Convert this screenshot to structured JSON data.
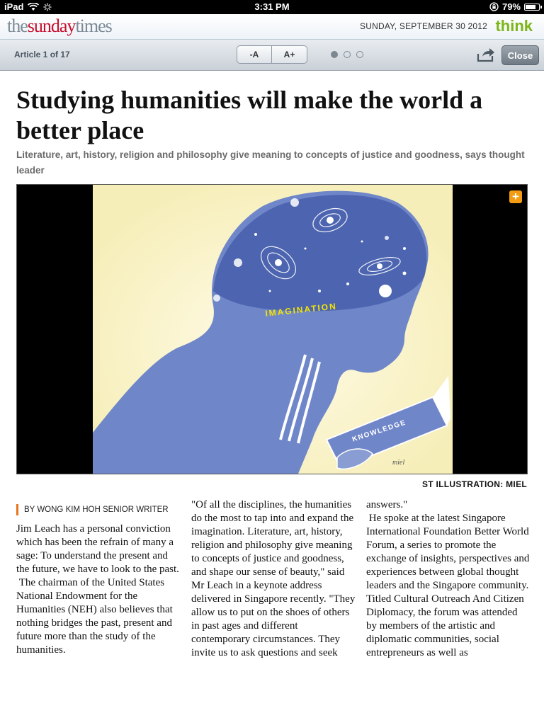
{
  "status_bar": {
    "device": "iPad",
    "time": "3:31 PM",
    "battery": "79%",
    "battery_level": 0.79
  },
  "masthead": {
    "logo_the": "the",
    "logo_sunday": "sunday",
    "logo_times": "times",
    "date": "SUNDAY, SEPTEMBER 30 2012",
    "section": "think"
  },
  "toolbar": {
    "article_count": "Article 1 of 17",
    "font_decrease": "-A",
    "font_increase": "A+",
    "close_label": "Close",
    "page_dots": 3,
    "active_dot": 0
  },
  "article": {
    "headline": "Studying humanities will make the world a better place",
    "standfirst": "Literature, art, history, religion and philosophy give meaning to concepts of justice and goodness, says thought leader",
    "illustration_text_1": "IMAGINATION",
    "illustration_text_2": "KNOWLEDGE",
    "illustration_signature": "miel",
    "expand_label": "+",
    "credit": "ST ILLUSTRATION: MIEL",
    "byline": "BY WONG KIM HOH SENIOR WRITER",
    "col1_text": "Jim Leach has a personal conviction which has been the refrain of many a sage: To understand the present and the future, we have to look to the past.\n The chairman of the United States National Endowment for the Humanities (NEH) also believes that nothing bridges the past, present and future more than the study of the humanities.",
    "col2_text": "\"Of all the disciplines, the humanities do the most to tap into and expand the imagination. Literature, art, history, religion and philosophy give meaning to concepts of justice and goodness, and shape our sense of beauty,\" said Mr Leach in a keynote address delivered in Singapore recently. \"They allow us to put on the shoes of others in past ages and different contemporary circumstances. They invite us to ask questions and seek",
    "col3_text": "answers.\"\n He spoke at the latest Singapore International Foundation Better World Forum, a series to promote the exchange of insights, perspectives and experiences between global thought leaders and the Singapore community. Titled Cultural Outreach And Citizen Diplomacy, the forum was attended by members of the artistic and diplomatic communities, social entrepreneurs as well as"
  },
  "colors": {
    "brand_red": "#c8102e",
    "think_green": "#7cb518",
    "accent_orange": "#e8731c",
    "figure_blue": "#6f86c9"
  }
}
